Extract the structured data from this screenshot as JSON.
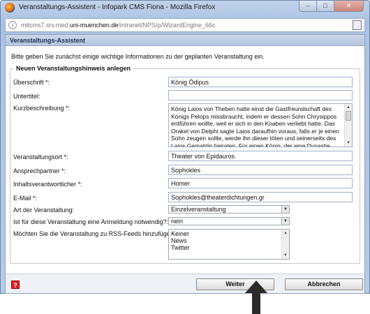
{
  "window": {
    "title": "Veranstaltungs-Assistent - Infopark CMS Fiona - Mozilla Firefox",
    "min_glyph": "–",
    "max_glyph": "□",
    "close_glyph": "✕"
  },
  "urlbar": {
    "url_prefix": "mitcms7.srv.med.",
    "url_domain": "uni-muenchen.de",
    "url_path": "/intranet/NPS/p/WizardEngine_66c"
  },
  "dialog": {
    "header": "Veranstaltungs-Assistent",
    "intro": "Bitte geben Sie zunächst einige wichtige Informationen zu der geplanten Veranstaltung ein.",
    "legend": "Neuen Veranstaltungshinweis anlegen"
  },
  "form": {
    "ueberschrift": {
      "label": "Überschrift *:",
      "value": "König Ödipus"
    },
    "untertitel": {
      "label": "Untertitel:",
      "value": ""
    },
    "kurzbeschreibung": {
      "label": "Kurzbeschreibung *:",
      "value": "König Laios von Theben hatte einst die Gastfreundschaft des Königs Pelops missbraucht, indem er dessen Sohn Chrysippos entführen wollte, weil er sich in den Knaben verliebt hatte. Das Orakel von Delphi sagte Laios daraufhin voraus, falls er je einen Sohn zeugen sollte, werde ihn dieser töten und seinerseits des Laios Gemahlin heiraten. Für einen König, der eine Dynastie"
    },
    "ort": {
      "label": "Veranstaltungsort *:",
      "value": "Theater von Epidauros"
    },
    "ansprechpartner": {
      "label": "Ansprechpartner *:",
      "value": "Sophokles"
    },
    "inhaltsverantwortlicher": {
      "label": "Inhaltsverantwortlicher *:",
      "value": "Homer"
    },
    "email": {
      "label": "E-Mail *:",
      "value": "Sophokles@theaterdichtungen.gr"
    },
    "art": {
      "label": "Art der Veranstaltung:",
      "value": "Einzelveranstaltung"
    },
    "anmeldung": {
      "label": "Ist für diese Veranstaltung eine Anmeldung notwendig?:",
      "value": "nein"
    },
    "rss": {
      "label": "Möchten Sie die Veranstaltung zu RSS-Feeds hinzufügen!:",
      "options": [
        "Keiner",
        "News",
        "Twitter"
      ]
    }
  },
  "footer": {
    "help_glyph": "?",
    "next_label": "Weiter",
    "cancel_label": "Abbrechen"
  },
  "colors": {
    "titlebar": "#aac2e3",
    "dialog_header": "#b3c6e0",
    "help_icon": "#dd2222",
    "annotation_arrow": "#2b2b2b"
  }
}
